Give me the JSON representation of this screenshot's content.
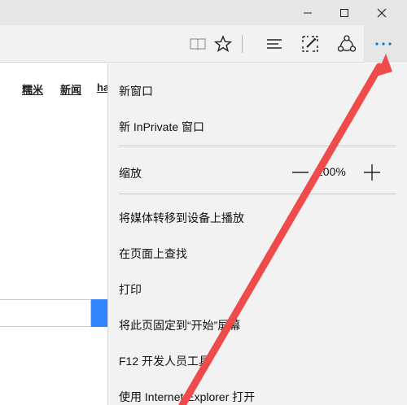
{
  "window": {
    "minimize_icon": "minimize-icon",
    "maximize_icon": "maximize-icon",
    "close_icon": "close-icon"
  },
  "toolbar": {
    "icons": [
      "reading-view-icon",
      "favorite-star-icon",
      "hub-icon",
      "web-note-icon",
      "share-icon",
      "more-icon"
    ]
  },
  "page": {
    "links": [
      "糯米",
      "新闻",
      "ha"
    ]
  },
  "menu": {
    "new_window": "新窗口",
    "new_inprivate": "新 InPrivate 窗口",
    "zoom_label": "缩放",
    "zoom_value": "100%",
    "cast_media": "将媒体转移到设备上播放",
    "find_on_page": "在页面上查找",
    "print": "打印",
    "pin_to_start": "将此页固定到“开始”屏幕",
    "f12_tools": "F12 开发人员工具",
    "open_with_ie": "使用 Internet Explorer 打开"
  },
  "colors": {
    "accent": "#0078d7",
    "annotation": "#f04b4b",
    "menu_bg": "#f2f2f2",
    "titlebar_bg": "#e6e6e6"
  }
}
